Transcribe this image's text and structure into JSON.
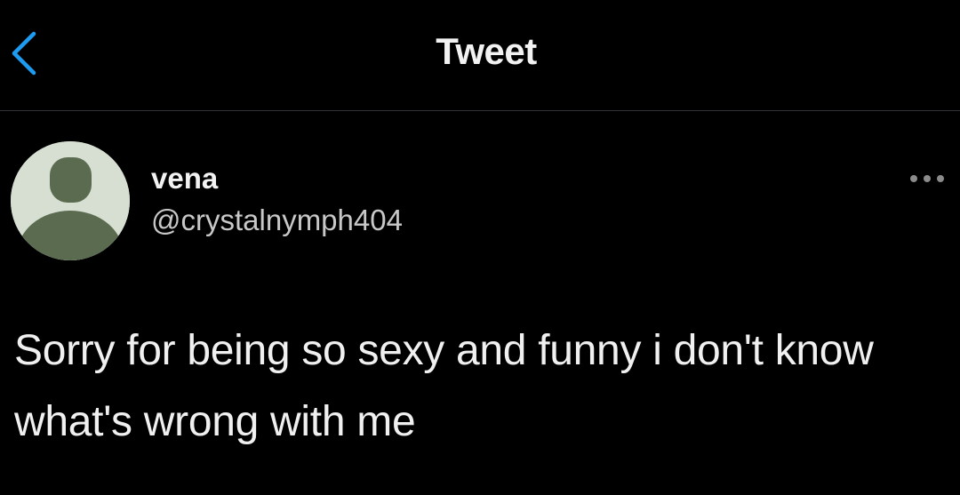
{
  "header": {
    "title": "Tweet",
    "back_icon": "chevron-left-icon"
  },
  "tweet": {
    "author": {
      "display_name": "vena",
      "handle": "@crystalnymph404",
      "avatar_icon": "default-profile-icon"
    },
    "more_icon": "ellipsis-icon",
    "text": "Sorry for being so sexy and funny i don't know what's wrong with me"
  },
  "colors": {
    "background": "#000000",
    "accent": "#1d9bf0",
    "divider": "#2f3336",
    "avatar_bg": "#d7dfd2",
    "avatar_figure": "#5a6b4f"
  }
}
